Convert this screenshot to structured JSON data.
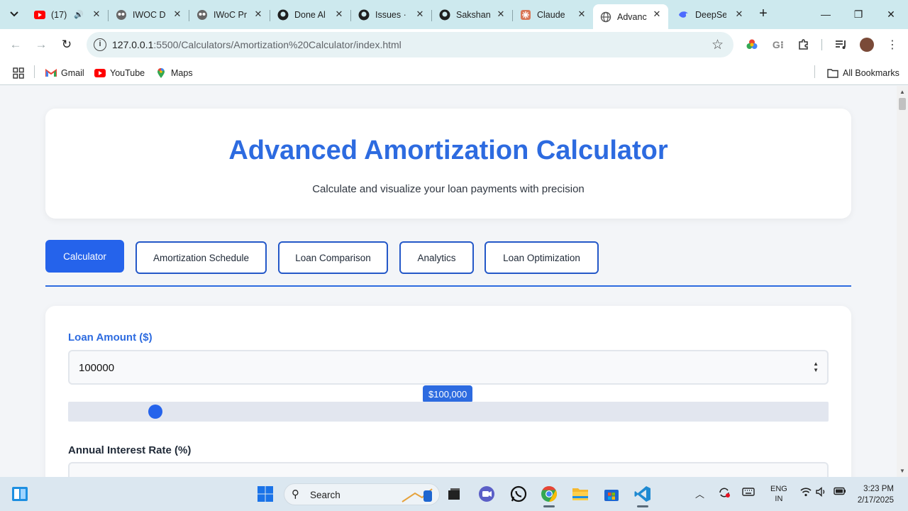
{
  "browser": {
    "tabs": [
      {
        "title": "(17)",
        "icon": "youtube-icon"
      },
      {
        "title": "IWOC D",
        "icon": "owl-icon"
      },
      {
        "title": "IWoC Pr",
        "icon": "owl-icon"
      },
      {
        "title": "Done Al",
        "icon": "github-icon"
      },
      {
        "title": "Issues ·",
        "icon": "github-icon"
      },
      {
        "title": "Sakshan",
        "icon": "github-icon"
      },
      {
        "title": "Claude",
        "icon": "claude-icon"
      },
      {
        "title": "Advanc",
        "icon": "globe-icon"
      },
      {
        "title": "DeepSe",
        "icon": "deepseek-icon"
      }
    ],
    "active_tab_index": 7,
    "url_host": "127.0.0.1",
    "url_path": ":5500/Calculators/Amortization%20Calculator/index.html",
    "bookmarks": [
      {
        "label": "Gmail",
        "icon": "gmail-icon"
      },
      {
        "label": "YouTube",
        "icon": "youtube-icon"
      },
      {
        "label": "Maps",
        "icon": "maps-icon"
      }
    ],
    "all_bookmarks": "All Bookmarks"
  },
  "page": {
    "title": "Advanced Amortization Calculator",
    "subtitle": "Calculate and visualize your loan payments with precision",
    "tabs": [
      {
        "label": "Calculator",
        "active": true
      },
      {
        "label": "Amortization Schedule",
        "active": false
      },
      {
        "label": "Loan Comparison",
        "active": false
      },
      {
        "label": "Analytics",
        "active": false
      },
      {
        "label": "Loan Optimization",
        "active": false
      }
    ],
    "loan_amount": {
      "label": "Loan Amount ($)",
      "value": "100000",
      "tooltip": "$100,000",
      "slider_fraction": 0.115
    },
    "interest_rate": {
      "label": "Annual Interest Rate (%)"
    }
  },
  "taskbar": {
    "search_placeholder": "Search",
    "lang_line1": "ENG",
    "lang_line2": "IN",
    "time": "3:23 PM",
    "date": "2/17/2025"
  },
  "colors": {
    "accent": "#2563eb",
    "title_blue": "#2d6be0",
    "tabstrip": "#cde9ee"
  }
}
